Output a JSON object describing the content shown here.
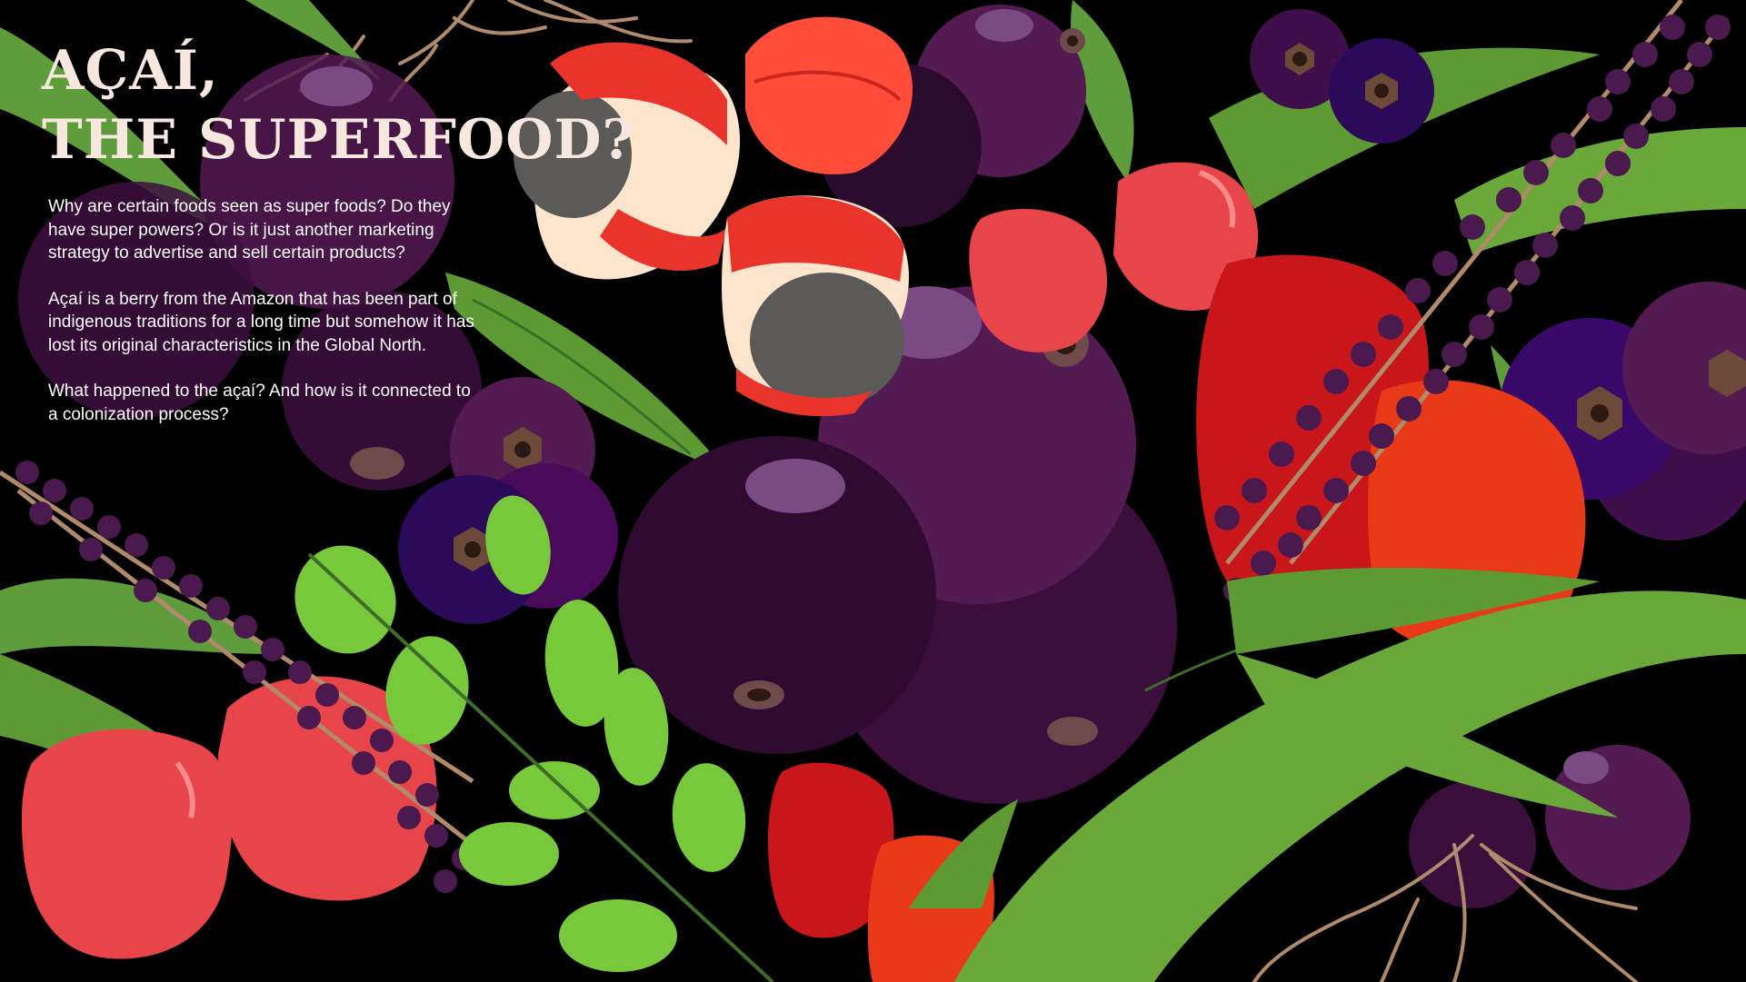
{
  "title": {
    "line1": "AÇAÍ,",
    "line2": "THE SUPERFOOD?"
  },
  "intro": {
    "paragraph1": "Why are certain foods seen as super foods? Do they have super powers? Or is it just another marketing strategy to advertise and sell certain products?",
    "paragraph2": "Açaí is a berry from the Amazon that has been part of indigenous traditions for a long time but somehow it has lost its original characteristics in the Global North.",
    "paragraph3": "What happened to the açaí? And how is it connected to a colonization process?"
  },
  "colors": {
    "background": "#000000",
    "acai_purple": "#3d0f3f",
    "acai_dark": "#2a0b2e",
    "acai_highlight": "#7a4a82",
    "guarana_red": "#e8342a",
    "guarana_aril": "#fde4cc",
    "guarana_seed": "#5c5a58",
    "acerola_red": "#e8454a",
    "leaf_green": "#6aa83a",
    "leaf_light": "#78c83c",
    "cashew_orange": "#e83a18",
    "root_tan": "#b08a6a",
    "title_color": "#f6e7df"
  }
}
